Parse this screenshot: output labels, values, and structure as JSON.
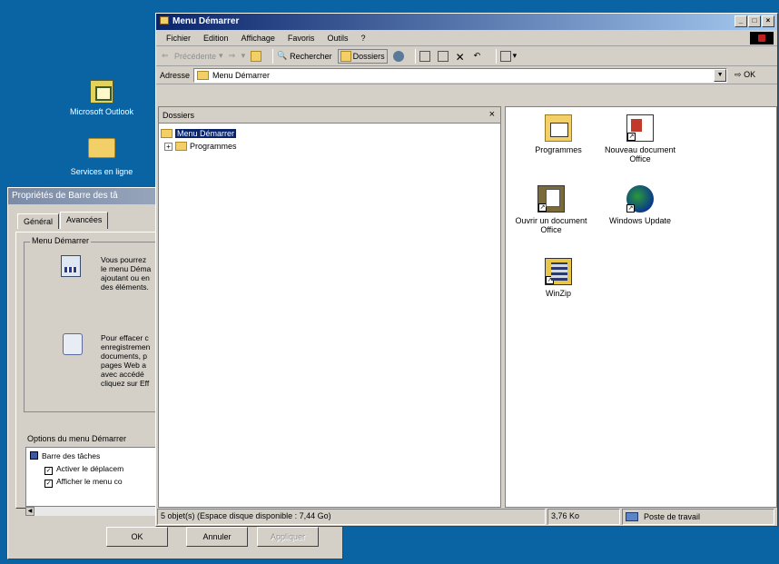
{
  "desktop": {
    "icons": [
      {
        "label": "Microsoft Outlook",
        "icon": "outlook-icon"
      },
      {
        "label": "Services en ligne",
        "icon": "folder-icon"
      }
    ]
  },
  "dialog": {
    "title": "Propriétés de Barre des tâ",
    "tabs": [
      "Général",
      "Avancées"
    ],
    "group_label": "Menu Démarrer",
    "text1": [
      "Vous pourrez",
      "le menu Déma",
      "ajoutant ou en",
      "des éléments."
    ],
    "text2": [
      "Pour effacer c",
      "enregistremen",
      "documents, p",
      "pages Web a",
      "avec accédé",
      "cliquez sur Eff"
    ],
    "options_label": "Options du menu Démarrer",
    "options": [
      {
        "label": "Barre des tâches",
        "checked": false
      },
      {
        "label": "Activer le déplacem",
        "checked": true
      },
      {
        "label": "Afficher le menu co",
        "checked": true
      }
    ],
    "buttons": {
      "ok": "OK",
      "cancel": "Annuler",
      "apply": "Appliquer"
    }
  },
  "window": {
    "title": "Menu Démarrer",
    "menus": [
      {
        "label": "Fichier",
        "ul": "F"
      },
      {
        "label": "Edition",
        "ul": "E"
      },
      {
        "label": "Affichage",
        "ul": "h"
      },
      {
        "label": "Favoris",
        "ul": "v"
      },
      {
        "label": "Outils",
        "ul": "O"
      },
      {
        "label": "?",
        "ul": ""
      }
    ],
    "toolbar": {
      "back": "Précédente",
      "search": "Rechercher",
      "folders": "Dossiers"
    },
    "address": {
      "label": "Adresse",
      "value": "Menu Démarrer",
      "go": "OK"
    },
    "folders_pane": {
      "title": "Dossiers",
      "tree": [
        {
          "label": "Menu Démarrer",
          "selected": true
        },
        {
          "label": "Programmes",
          "selected": false
        }
      ]
    },
    "files": [
      {
        "label": "Programmes",
        "icon": "programs-folder-icon"
      },
      {
        "label": "Nouveau document Office",
        "icon": "new-office-document-icon"
      },
      {
        "label": "Ouvrir un document Office",
        "icon": "open-office-document-icon"
      },
      {
        "label": "Windows Update",
        "icon": "windows-update-icon"
      },
      {
        "label": "WinZip",
        "icon": "winzip-icon"
      }
    ],
    "status": {
      "objects": "5 objet(s) (Espace disque disponible : 7,44 Go)",
      "size": "3,76 Ko",
      "zone": "Poste de travail"
    }
  }
}
